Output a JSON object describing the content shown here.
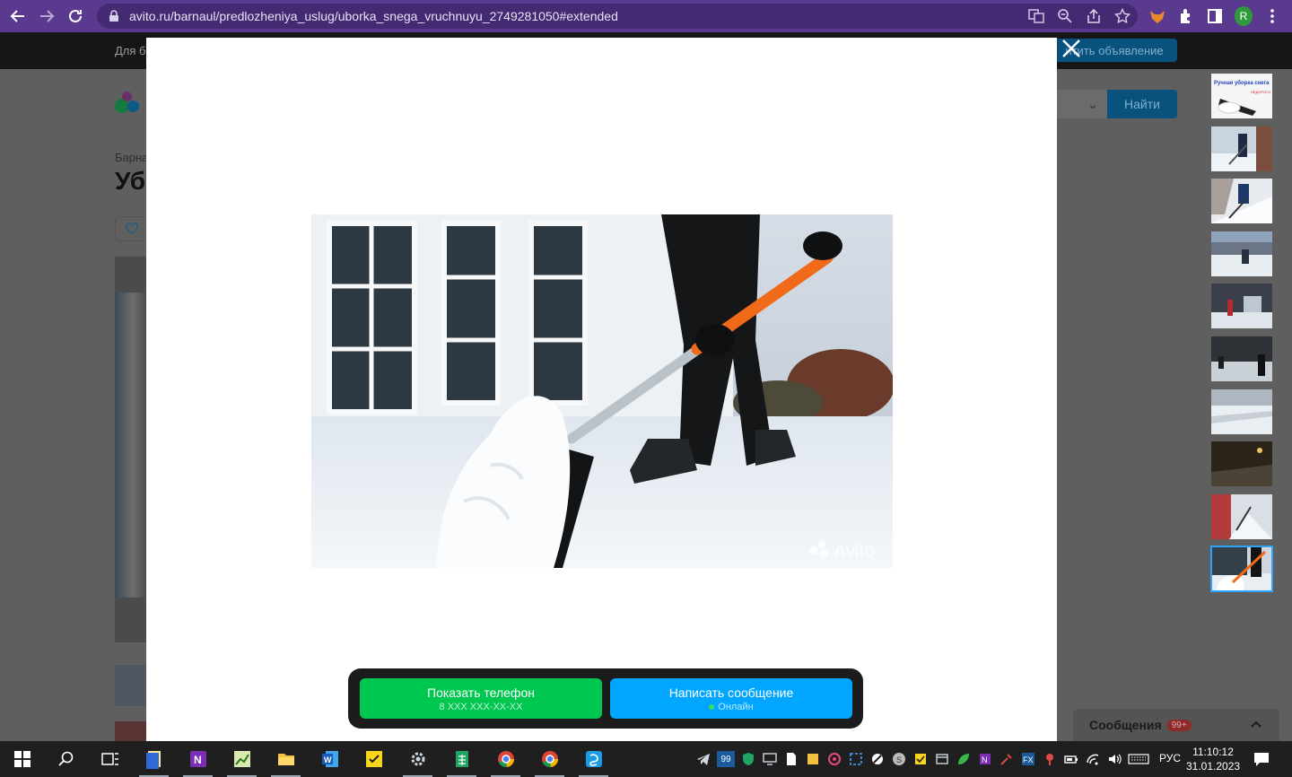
{
  "browser": {
    "url": "avito.ru/barnaul/predlozheniya_uslug/uborka_snega_vruchnuyu_2749281050#extended",
    "profile_initial": "R",
    "theme_color": "#5a3a8e"
  },
  "page": {
    "for_business": "Для би",
    "place_ad": "Разместить объявление",
    "place_ad_visible": "итить объявление",
    "search_button": "Найти",
    "breadcrumb": "Барнаул",
    "breadcrumb_visible": "Барна",
    "title_visible": "Уб",
    "messenger_label": "Сообщения",
    "messenger_badge": "99+"
  },
  "modal": {
    "close_icon": "close-icon",
    "watermark": "Avito",
    "phone_button": {
      "label": "Показать телефон",
      "sub": "8 XXX XXX-XX-XX",
      "color": "#00c750"
    },
    "message_button": {
      "label": "Написать сообщение",
      "sub": "Онлайн",
      "color": "#00a6ff"
    },
    "thumbnail_count": 10,
    "active_thumbnail": 10,
    "first_thumb_caption": "Ручная уборка снега",
    "first_thumb_sub": "НЕДОРОГО"
  },
  "taskbar": {
    "tray_badge": "99",
    "language": "РУС",
    "time": "11:10:12",
    "date": "31.01.2023"
  }
}
